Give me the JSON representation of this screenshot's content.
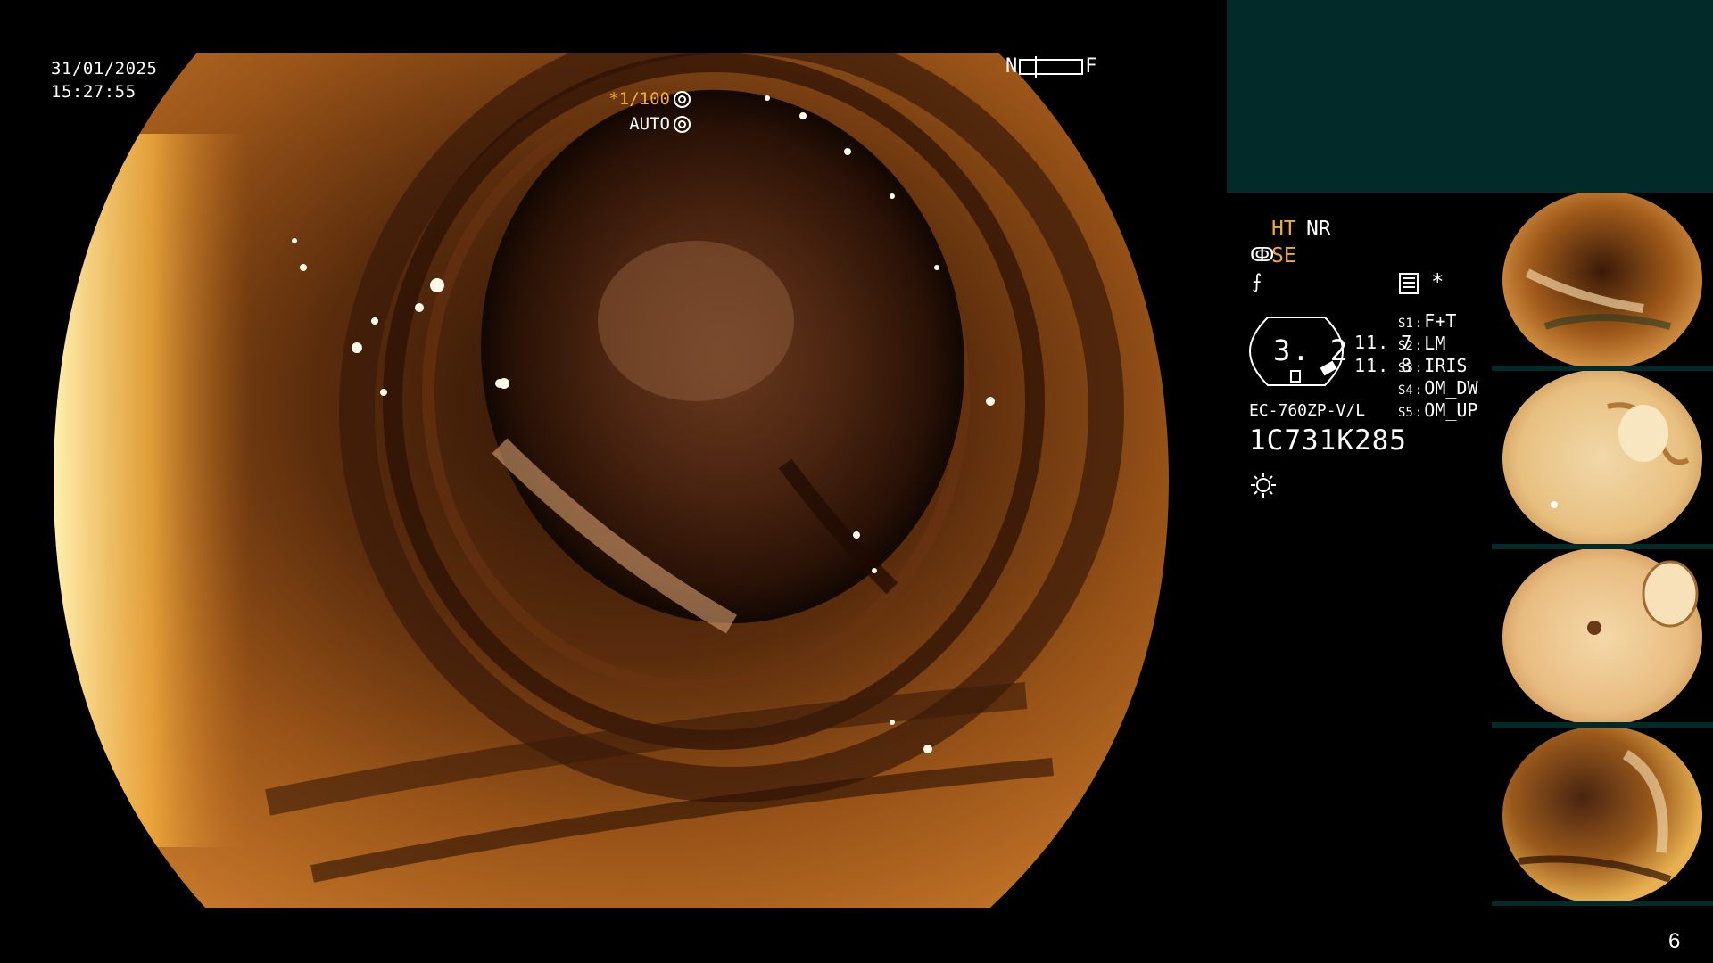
{
  "main": {
    "date": "31/01/2025",
    "time": "15:27:55",
    "nf_left": "N",
    "nf_right": "F",
    "shutter": "*1/100",
    "auto": "AUTO"
  },
  "info": {
    "ht": "HT",
    "nr": "NR",
    "se": "SE",
    "asterisk": "*",
    "gauge_value": "3. 2",
    "value1": "11. 7",
    "value2": "11. 8",
    "settings": [
      {
        "label": "S1",
        "value": "F+T"
      },
      {
        "label": "S2",
        "value": "LM"
      },
      {
        "label": "S3",
        "value": "IRIS"
      },
      {
        "label": "S4",
        "value": "OM_DW"
      },
      {
        "label": "S5",
        "value": "OM_UP"
      }
    ],
    "scope_model": "EC-760ZP-V/L",
    "scope_serial": "1C731K285"
  },
  "page_number": "6",
  "colors": {
    "accent_orange": "#f2a93b",
    "panel_teal": "#012a28"
  },
  "icons": [
    "shutter-icon",
    "auto-iris-icon",
    "se-icon",
    "freeze-icon",
    "memo-icon",
    "light-icon"
  ]
}
